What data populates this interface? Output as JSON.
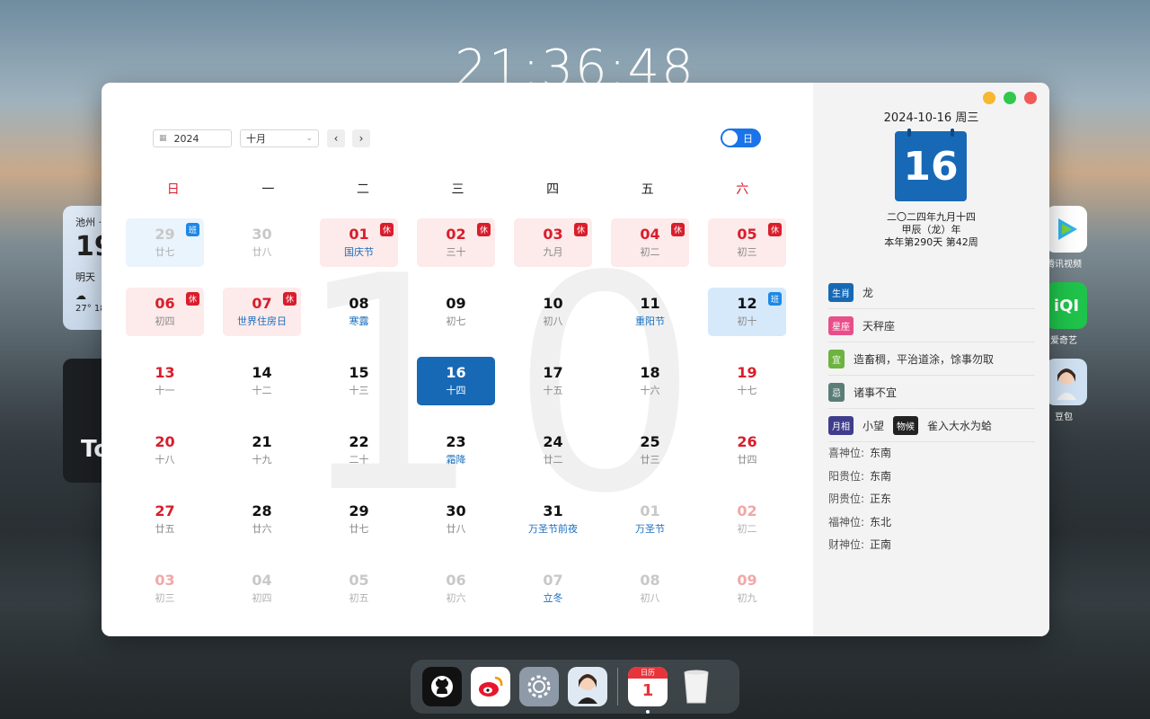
{
  "desktop": {
    "clock": "21:36:48",
    "weather": {
      "city": "池州 ·",
      "temp": "19",
      "tomorrow": "明天",
      "range": "27° 18"
    },
    "dark_widget_text": "To",
    "side_apps": [
      {
        "name": "腾讯视频",
        "icon": "play-icon"
      },
      {
        "name": "爱奇艺",
        "icon": "iqiyi-icon"
      },
      {
        "name": "豆包",
        "icon": "avatar-icon"
      }
    ]
  },
  "toolbar": {
    "year": "2024",
    "month": "十月",
    "toggle_label": "日"
  },
  "background_month": "10",
  "weekdays": [
    "日",
    "一",
    "二",
    "三",
    "四",
    "五",
    "六"
  ],
  "days": [
    {
      "d": "29",
      "s": "廿七",
      "kind": "faded workday-faded",
      "badge": "班",
      "btype": "work"
    },
    {
      "d": "30",
      "s": "廿八",
      "kind": "faded"
    },
    {
      "d": "01",
      "s": "国庆节",
      "kind": "holiday",
      "badge": "休",
      "btype": "rest",
      "fest": true
    },
    {
      "d": "02",
      "s": "三十",
      "kind": "holiday",
      "badge": "休",
      "btype": "rest"
    },
    {
      "d": "03",
      "s": "九月",
      "kind": "holiday",
      "badge": "休",
      "btype": "rest"
    },
    {
      "d": "04",
      "s": "初二",
      "kind": "holiday",
      "badge": "休",
      "btype": "rest"
    },
    {
      "d": "05",
      "s": "初三",
      "kind": "holiday",
      "badge": "休",
      "btype": "rest"
    },
    {
      "d": "06",
      "s": "初四",
      "kind": "holiday",
      "badge": "休",
      "btype": "rest"
    },
    {
      "d": "07",
      "s": "世界住房日",
      "kind": "holiday",
      "badge": "休",
      "btype": "rest",
      "fest": true
    },
    {
      "d": "08",
      "s": "寒露",
      "kind": "",
      "fest": true
    },
    {
      "d": "09",
      "s": "初七",
      "kind": ""
    },
    {
      "d": "10",
      "s": "初八",
      "kind": ""
    },
    {
      "d": "11",
      "s": "重阳节",
      "kind": "",
      "fest": true
    },
    {
      "d": "12",
      "s": "初十",
      "kind": "workday",
      "badge": "班",
      "btype": "work"
    },
    {
      "d": "13",
      "s": "十一",
      "kind": "weekend"
    },
    {
      "d": "14",
      "s": "十二",
      "kind": ""
    },
    {
      "d": "15",
      "s": "十三",
      "kind": ""
    },
    {
      "d": "16",
      "s": "十四",
      "kind": "today"
    },
    {
      "d": "17",
      "s": "十五",
      "kind": ""
    },
    {
      "d": "18",
      "s": "十六",
      "kind": ""
    },
    {
      "d": "19",
      "s": "十七",
      "kind": "weekend"
    },
    {
      "d": "20",
      "s": "十八",
      "kind": "weekend"
    },
    {
      "d": "21",
      "s": "十九",
      "kind": ""
    },
    {
      "d": "22",
      "s": "二十",
      "kind": ""
    },
    {
      "d": "23",
      "s": "霜降",
      "kind": "",
      "fest": true
    },
    {
      "d": "24",
      "s": "廿二",
      "kind": ""
    },
    {
      "d": "25",
      "s": "廿三",
      "kind": ""
    },
    {
      "d": "26",
      "s": "廿四",
      "kind": "weekend"
    },
    {
      "d": "27",
      "s": "廿五",
      "kind": "weekend"
    },
    {
      "d": "28",
      "s": "廿六",
      "kind": ""
    },
    {
      "d": "29",
      "s": "廿七",
      "kind": ""
    },
    {
      "d": "30",
      "s": "廿八",
      "kind": ""
    },
    {
      "d": "31",
      "s": "万圣节前夜",
      "kind": "",
      "fest": true
    },
    {
      "d": "01",
      "s": "万圣节",
      "kind": "faded",
      "fest": true
    },
    {
      "d": "02",
      "s": "初二",
      "kind": "faded weekend"
    },
    {
      "d": "03",
      "s": "初三",
      "kind": "faded weekend"
    },
    {
      "d": "04",
      "s": "初四",
      "kind": "faded"
    },
    {
      "d": "05",
      "s": "初五",
      "kind": "faded"
    },
    {
      "d": "06",
      "s": "初六",
      "kind": "faded"
    },
    {
      "d": "07",
      "s": "立冬",
      "kind": "faded",
      "fest": true
    },
    {
      "d": "08",
      "s": "初八",
      "kind": "faded"
    },
    {
      "d": "09",
      "s": "初九",
      "kind": "faded weekend"
    }
  ],
  "info": {
    "date": "2024-10-16 周三",
    "day": "16",
    "lunar_date": "二〇二四年九月十四",
    "ganzhi": "甲辰（龙）年",
    "year_progress": "本年第290天 第42周",
    "rows": {
      "shengxiao_tag": "生肖",
      "shengxiao": "龙",
      "xingzuo_tag": "星座",
      "xingzuo": "天秤座",
      "yi_tag": "宜",
      "yi": "造畜稠，平治道涂，馀事勿取",
      "ji_tag": "忌",
      "ji": "诸事不宜",
      "yuexiang_tag": "月相",
      "yuexiang": "小望",
      "wuhou_tag": "物候",
      "wuhou": "雀入大水为蛤"
    },
    "positions": [
      {
        "label": "喜神位:",
        "value": "东南"
      },
      {
        "label": "阳贵位:",
        "value": "东南"
      },
      {
        "label": "阴贵位:",
        "value": "正东"
      },
      {
        "label": "福神位:",
        "value": "东北"
      },
      {
        "label": "财神位:",
        "value": "正南"
      }
    ]
  },
  "dock": {
    "calendar_header": "日历",
    "calendar_day": "1"
  }
}
